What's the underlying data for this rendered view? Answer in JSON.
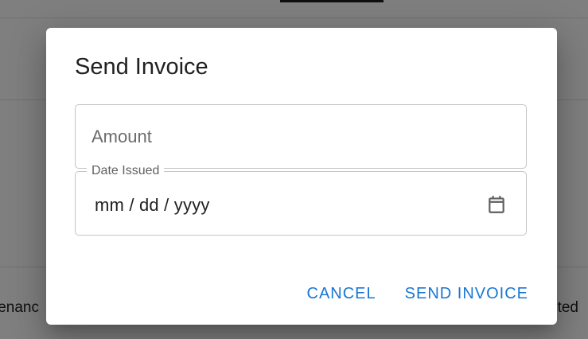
{
  "background": {
    "left_text": "enanc",
    "right_text": "eted"
  },
  "dialog": {
    "title": "Send Invoice",
    "amount": {
      "placeholder": "Amount",
      "value": ""
    },
    "date_issued": {
      "label": "Date Issued",
      "value": "mm / dd / yyyy",
      "icon": "calendar-icon"
    },
    "actions": {
      "cancel_label": "CANCEL",
      "send_label": "SEND INVOICE"
    }
  },
  "colors": {
    "accent": "#1976d2",
    "backdrop": "rgba(0,0,0,0.5)",
    "border": "#c4c4c4"
  }
}
